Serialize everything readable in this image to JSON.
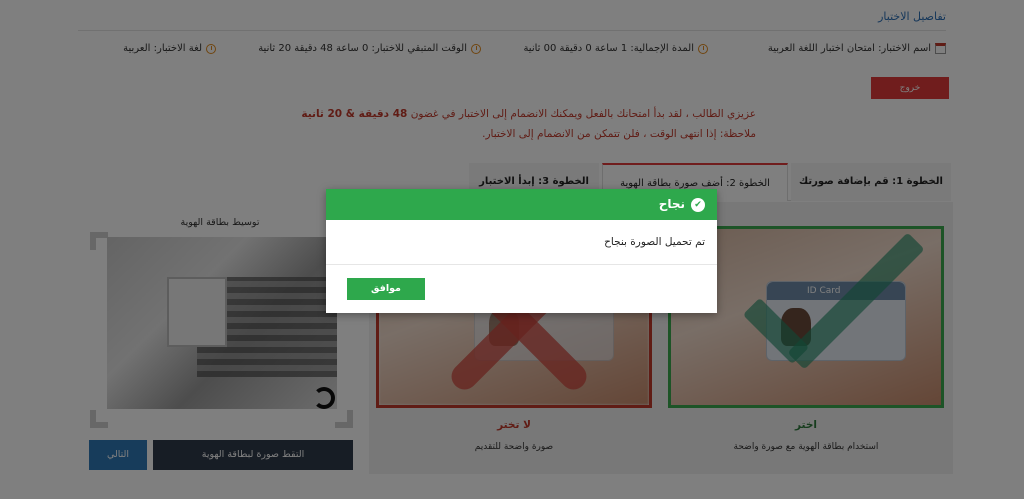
{
  "header": {
    "title": "تفاصيل الاختبار"
  },
  "info": {
    "exam_name": "اسم الاختبار: امتحان اختبار اللغة العربية",
    "total_duration": "المدة الإجمالية: 1 ساعة 0 دقيقة 00 ثانية",
    "remaining_time": "الوقت المتبقي للاختبار: 0 ساعة 48 دقيقة 20 ثانية",
    "exam_language": "لغة الاختبار: العربية"
  },
  "exit_label": "خروج",
  "notice": {
    "line1_prefix": "عزيزي الطالب ، لقد بدأ امتحانك بالفعل ويمكنك الانضمام إلى الاختبار في غضون",
    "line1_bold": "48 دقيقة & 20 ثانية",
    "line2": "ملاحظة: إذا انتهى الوقت ، فلن تتمكن من الانضمام إلى الاختبار."
  },
  "tabs": [
    {
      "label": "الخطوة 1: قم بإضافة صورتك"
    },
    {
      "label": "الخطوة 2: أضف صورة بطاقة الهوية"
    },
    {
      "label": "الخطوة 3: إبدأ الاختبار"
    }
  ],
  "preview": {
    "title": "توسيط بطاقة الهوية"
  },
  "buttons": {
    "capture": "التقط صورة لبطاقة الهوية",
    "next": "التالي"
  },
  "examples": {
    "good": {
      "title": "اختر",
      "desc": "استخدام بطاقة الهوية مع صورة واضحة",
      "card_text": "ID Card"
    },
    "bad": {
      "title": "لا تختر",
      "desc": "صورة واضحة للتقديم"
    }
  },
  "modal": {
    "title": "نجاح",
    "message": "تم تحميل الصورة بنجاح",
    "ok": "موافق"
  },
  "colors": {
    "success": "#2ea84c",
    "danger": "#e03b3b",
    "dark": "#2f3a4b",
    "primary": "#2f78b6"
  }
}
